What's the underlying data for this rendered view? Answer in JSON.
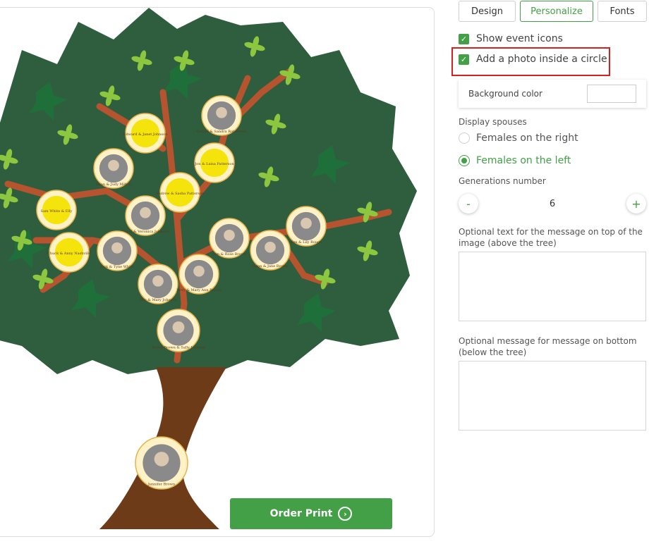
{
  "tabs": [
    "Design",
    "Personalize",
    "Fonts"
  ],
  "active_tab": "Personalize",
  "options": {
    "show_event_icons": {
      "label": "Show event icons",
      "checked": true
    },
    "add_photo_circle": {
      "label": "Add a photo inside a circle",
      "checked": true
    }
  },
  "background_color": {
    "label": "Background color",
    "value": "#ffffff"
  },
  "display_spouses": {
    "label": "Display spouses",
    "options": [
      "Females on the right",
      "Females on the left"
    ],
    "selected": "Females on the left"
  },
  "generations": {
    "label": "Generations number",
    "value": "6",
    "minus": "-",
    "plus": "+"
  },
  "top_message": {
    "label": "Optional text for the message on top of the image (above the tree)",
    "value": ""
  },
  "bottom_message": {
    "label": "Optional message for message on bottom (below the tree)",
    "value": ""
  },
  "order_button": {
    "label": "Order Print"
  },
  "tree_nodes": [
    {
      "title": "Edward & Janet Johnson",
      "photo": false
    },
    {
      "title": "Gerald & Sandra Robertson",
      "photo": true
    },
    {
      "title": "Jon & Luisa Patterson",
      "photo": false
    },
    {
      "title": "Dean & Judy Milton",
      "photo": true
    },
    {
      "title": "Andrew & Sasha Patterson",
      "photo": false
    },
    {
      "title": "Sam White & Elly",
      "photo": false
    },
    {
      "title": "David & Veronica Johnson",
      "photo": true
    },
    {
      "title": "Don & Rose Brown",
      "photo": true
    },
    {
      "title": "Ken & Lily Rouge",
      "photo": true
    },
    {
      "title": "Chuck & Anny Nashville",
      "photo": false
    },
    {
      "title": "Jack & Tyne White",
      "photo": true
    },
    {
      "title": "Jason & Jane Brown",
      "photo": true
    },
    {
      "title": "Eric & Mary Johnson",
      "photo": true
    },
    {
      "title": "Jerry & Mary Ann Brown",
      "photo": true
    },
    {
      "title": "Derek Brown & Sally Johnson",
      "photo": true
    },
    {
      "title": "Jennifer Brown",
      "photo": true
    }
  ],
  "colors": {
    "accent": "#43a047",
    "highlight": "#d62020",
    "trunk": "#6d3b17",
    "leaves": "#2e5e3e",
    "leaf_green": "#1f7a3a",
    "branch": "#b5542e",
    "node_yellow": "#f5e40c",
    "node_ring": "#fff2c7"
  }
}
